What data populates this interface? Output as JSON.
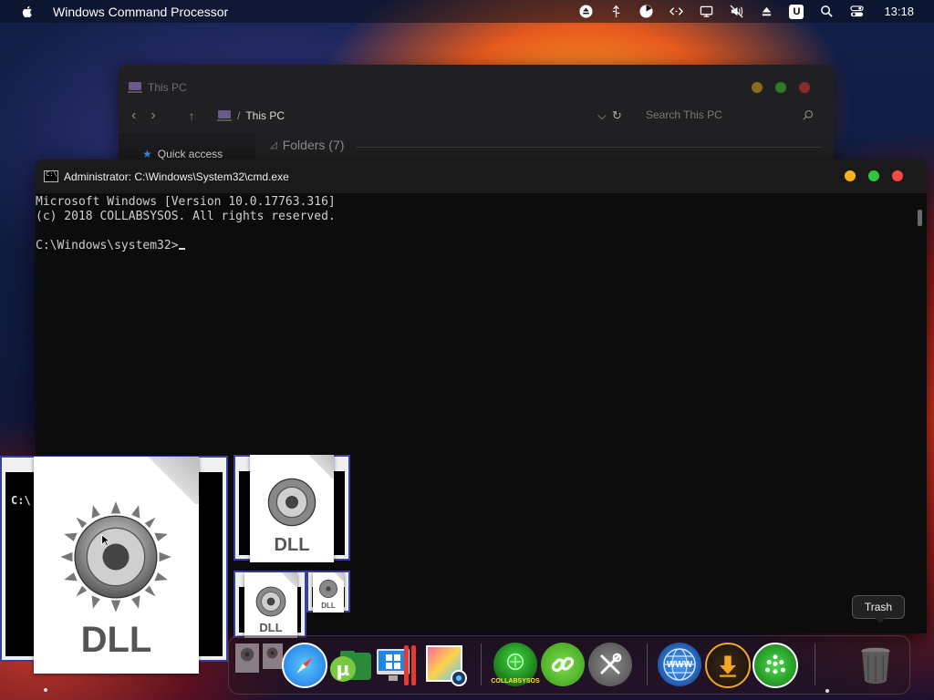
{
  "menubar": {
    "app_title": "Windows Command Processor",
    "clock": "13:18",
    "status_icons": [
      "eject-icon",
      "usb-icon",
      "pie-chart-icon",
      "code-icon",
      "display-icon",
      "sound-muted-icon",
      "upload-icon",
      "u-badge-icon",
      "search-icon",
      "control-center-icon"
    ],
    "u_badge": "U"
  },
  "explorer": {
    "title": "This PC",
    "path_label": "This PC",
    "search_placeholder": "Search This PC",
    "sidebar_quick_access": "Quick access",
    "folders_header": "Folders (7)"
  },
  "cmd": {
    "title": "Administrator: C:\\Windows\\System32\\cmd.exe",
    "lines": [
      "Microsoft Windows [Version 10.0.17763.316]",
      "(c) 2018 COLLABSYSOS. All rights reserved.",
      "",
      "C:\\Windows\\system32>"
    ]
  },
  "thumbnails": {
    "dll_label": "DLL",
    "mini_prompt": "C:\\"
  },
  "dock": {
    "trash_tooltip": "Trash",
    "collabsysos_label": "COLLABSYSOS",
    "www_label": "WWW",
    "items": [
      "Safari",
      "uTorrent",
      "Windows Parallels",
      "Photo Viewer",
      "COLLABSYSOS",
      "Link",
      "System Tools",
      "Web Browser",
      "Downloader",
      "Network",
      "Trash"
    ]
  },
  "colors": {
    "light_yellow": "#f5b11f",
    "light_green": "#2fc53a",
    "light_red": "#f34a43",
    "console_bg": "#0c0c0c",
    "console_fg": "#cfcfcf"
  }
}
